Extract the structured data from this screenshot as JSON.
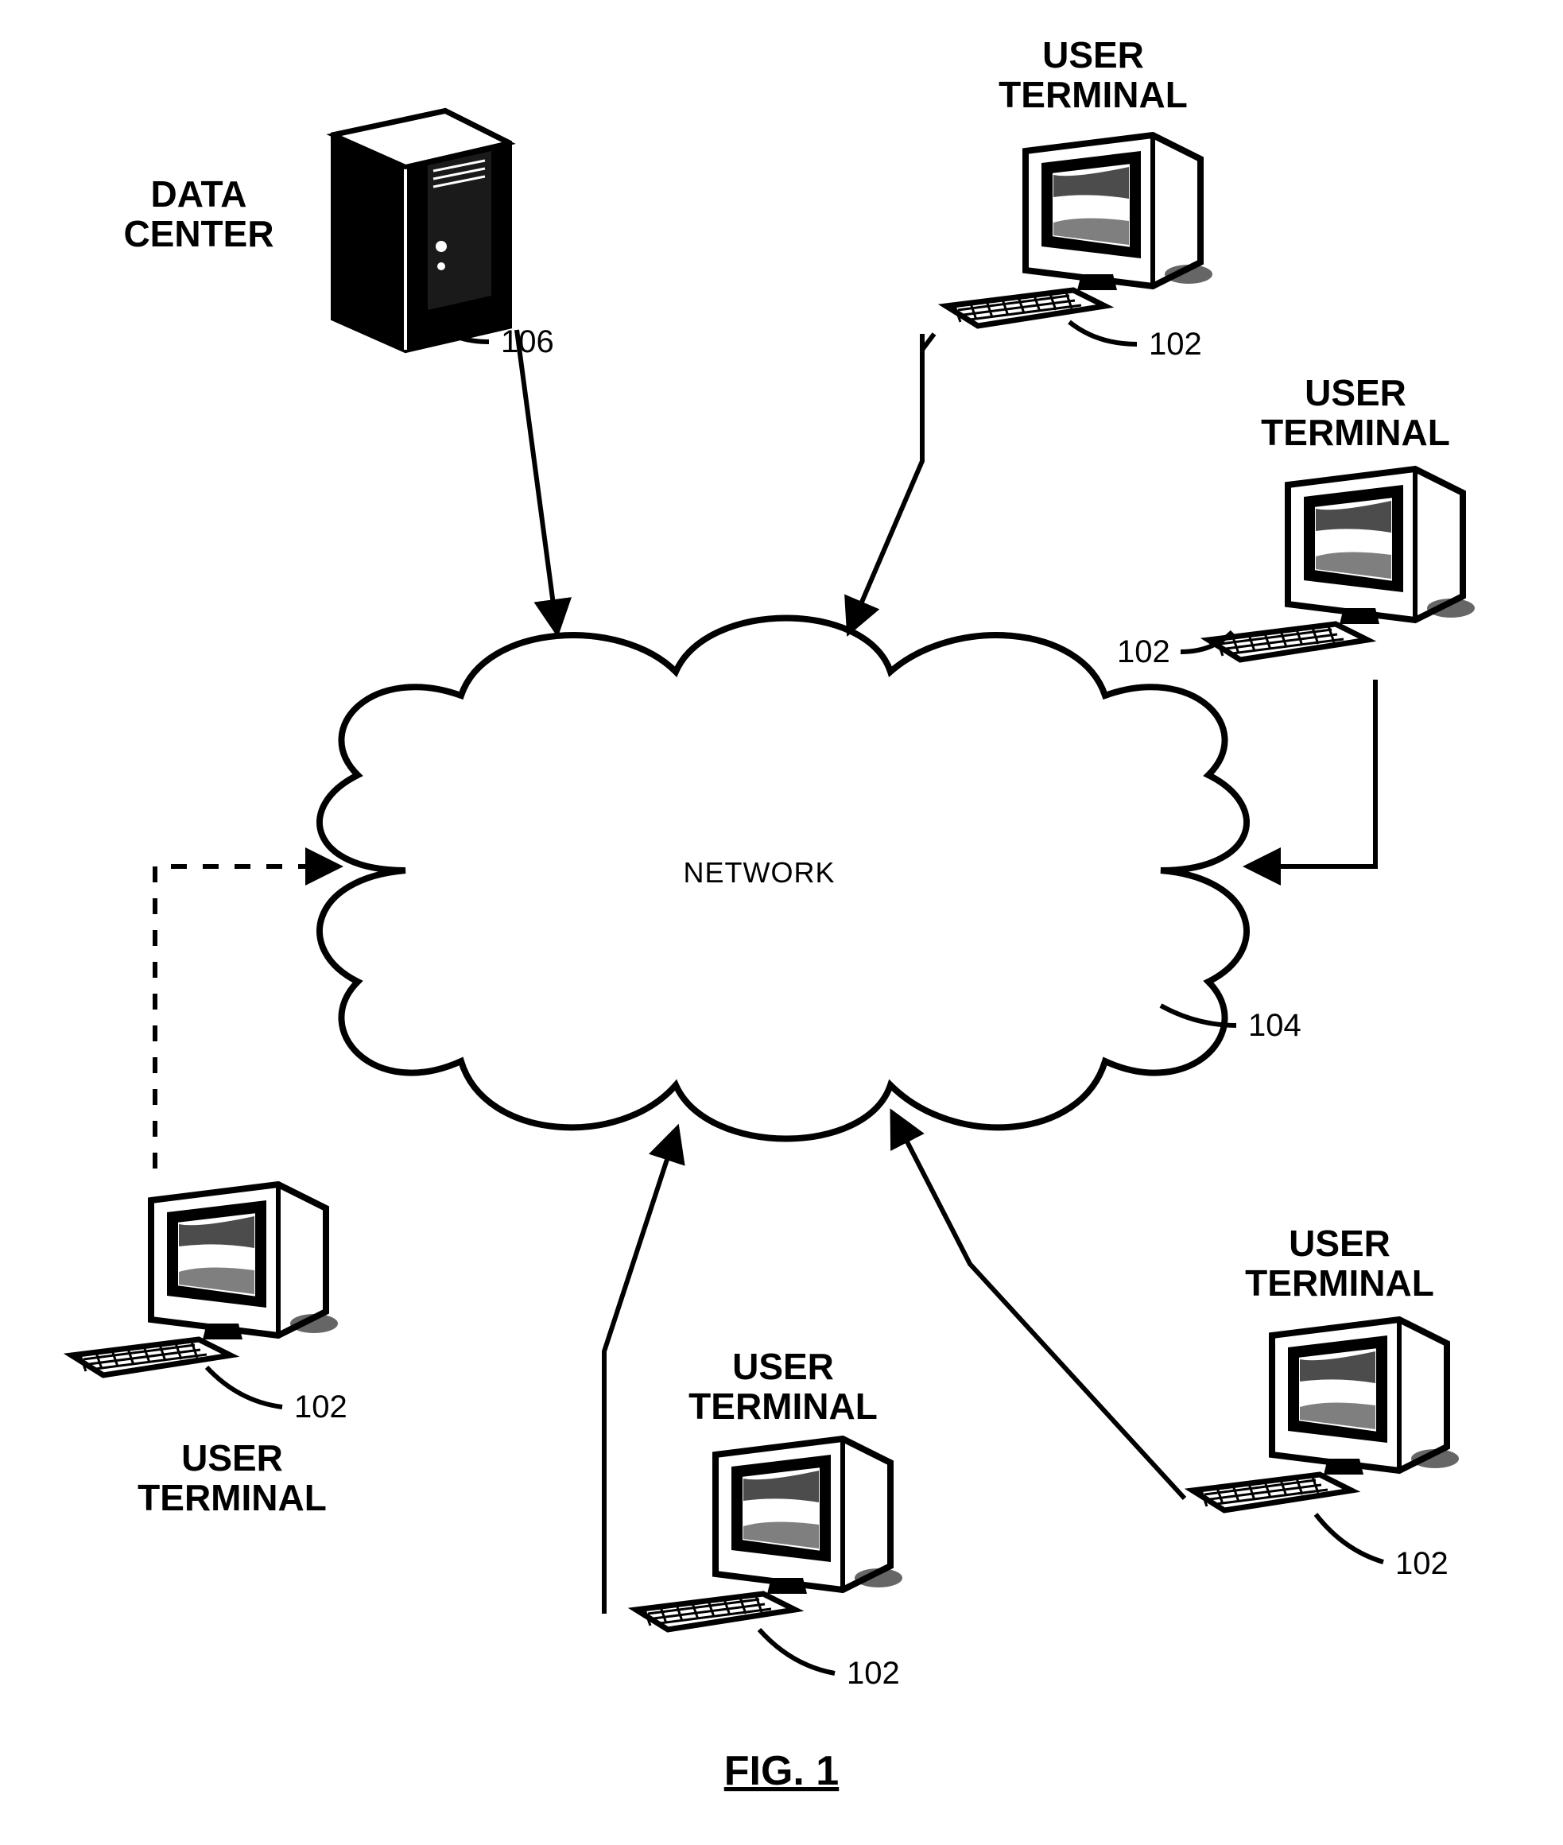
{
  "figure_caption": "FIG. 1",
  "network": {
    "label": "NETWORK",
    "ref": "104"
  },
  "data_center": {
    "label_line1": "DATA",
    "label_line2": "CENTER",
    "ref": "106"
  },
  "terminals": {
    "top_right": {
      "label_line1": "USER",
      "label_line2": "TERMINAL",
      "ref": "102"
    },
    "right_upper": {
      "label_line1": "USER",
      "label_line2": "TERMINAL",
      "ref": "102"
    },
    "right_lower": {
      "label_line1": "USER",
      "label_line2": "TERMINAL",
      "ref": "102"
    },
    "bottom": {
      "label_line1": "USER",
      "label_line2": "TERMINAL",
      "ref": "102"
    },
    "left": {
      "label_line1": "USER",
      "label_line2": "TERMINAL",
      "ref": "102"
    }
  }
}
